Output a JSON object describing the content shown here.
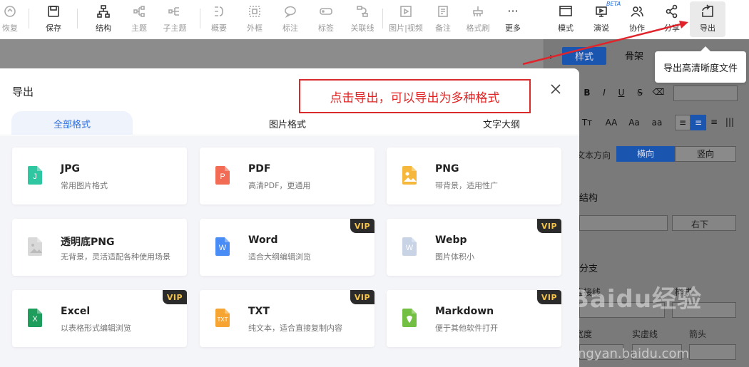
{
  "toolbar": {
    "items": [
      {
        "label": "恢复",
        "icon": "redo-icon"
      },
      {
        "label": "保存",
        "icon": "save-icon"
      },
      {
        "label": "结构",
        "icon": "structure-icon"
      },
      {
        "label": "主题",
        "icon": "topic-icon"
      },
      {
        "label": "子主题",
        "icon": "subtopic-icon"
      },
      {
        "label": "概要",
        "icon": "summary-icon"
      },
      {
        "label": "外框",
        "icon": "frame-icon"
      },
      {
        "label": "标注",
        "icon": "comment-icon"
      },
      {
        "label": "标签",
        "icon": "tag-icon"
      },
      {
        "label": "关联线",
        "icon": "relation-icon"
      },
      {
        "label": "图片|视频",
        "icon": "media-icon"
      },
      {
        "label": "备注",
        "icon": "note-icon"
      },
      {
        "label": "格式刷",
        "icon": "format-brush-icon"
      },
      {
        "label": "更多",
        "icon": "more-icon"
      },
      {
        "label": "模式",
        "icon": "mode-icon"
      },
      {
        "label": "演说",
        "icon": "present-icon"
      },
      {
        "label": "协作",
        "icon": "collab-icon"
      },
      {
        "label": "分享",
        "icon": "share-icon"
      },
      {
        "label": "导出",
        "icon": "export-icon"
      }
    ],
    "beta": "BETA",
    "tooltip": "导出高清晰度文件"
  },
  "right_panel": {
    "tab_style": "样式",
    "tab_skeleton": "骨架",
    "text_direction": "文本方向",
    "horizontal": "横向",
    "vertical": "竖向",
    "structure": "结构",
    "layout_value": "右下",
    "branch": "分支",
    "connector": "连接线",
    "style": "样式",
    "width": "宽度",
    "solid_line": "实虚线",
    "arrow": "箭头",
    "font_b": "B",
    "font_i": "I",
    "font_u": "U",
    "font_s": "S",
    "size_tt": "Tт",
    "size_aa_big": "AA",
    "size_aa": "Aa",
    "size_aa_small": "aa"
  },
  "dialog": {
    "title": "导出",
    "callout": "点击导出，可以导出为多种格式",
    "tabs": [
      {
        "label": "全部格式",
        "active": true
      },
      {
        "label": "图片格式",
        "active": false
      },
      {
        "label": "文字大纲",
        "active": false
      }
    ],
    "vip_label": "VIP",
    "formats": [
      {
        "name": "JPG",
        "desc": "常用图片格式",
        "vip": false,
        "color": "#2fc7a1",
        "letter": "J"
      },
      {
        "name": "PDF",
        "desc": "高清PDF，更通用",
        "vip": false,
        "color": "#f26b54",
        "letter": "P"
      },
      {
        "name": "PNG",
        "desc": "带背景，适用性广",
        "vip": false,
        "color": "#f5b83d",
        "letter": ""
      },
      {
        "name": "透明底PNG",
        "desc": "无背景，灵活适配各种使用场景",
        "vip": false,
        "color": "#d9d9d9",
        "letter": ""
      },
      {
        "name": "Word",
        "desc": "适合大纲编辑浏览",
        "vip": true,
        "color": "#4a8cf5",
        "letter": "W"
      },
      {
        "name": "Webp",
        "desc": "图片体积小",
        "vip": true,
        "color": "#c8d3e6",
        "letter": "W"
      },
      {
        "name": "Excel",
        "desc": "以表格形式编辑浏览",
        "vip": true,
        "color": "#1f9d5c",
        "letter": "X"
      },
      {
        "name": "TXT",
        "desc": "纯文本，适合直接复制内容",
        "vip": true,
        "color": "#f7a532",
        "letter": "TXT"
      },
      {
        "name": "Markdown",
        "desc": "便于其他软件打开",
        "vip": true,
        "color": "#72bf44",
        "letter": ""
      }
    ]
  },
  "watermark": {
    "logo": "Baidu经验",
    "url": "jingyan.baidu.com"
  }
}
